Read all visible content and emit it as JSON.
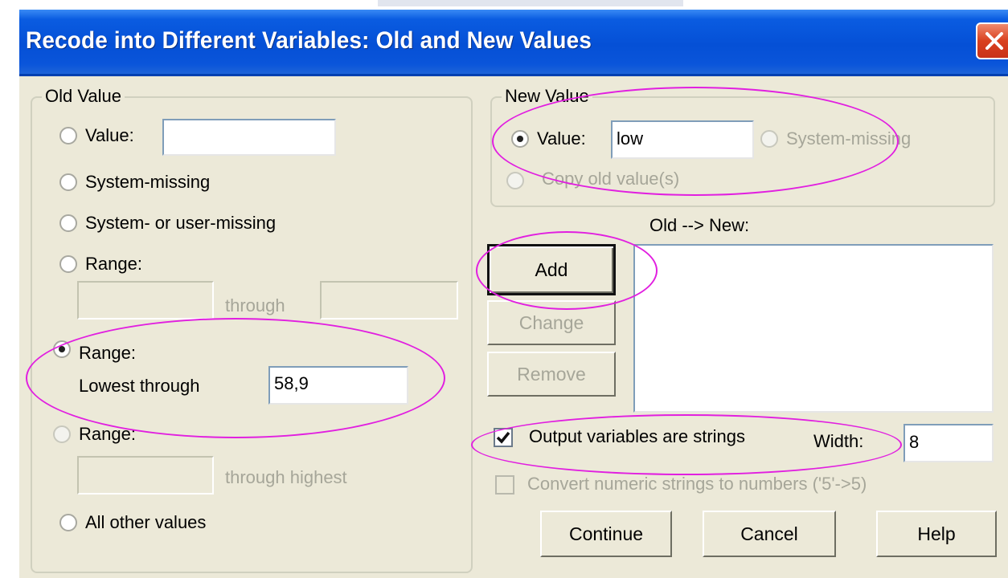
{
  "window": {
    "title": "Recode into Different Variables: Old and New Values"
  },
  "old_value": {
    "legend": "Old Value",
    "value_label": "Value:",
    "value_input": "",
    "system_missing": "System-missing",
    "system_or_user_missing": "System- or user-missing",
    "range_label": "Range:",
    "range_from": "",
    "range_through": "through",
    "range_to": "",
    "range_lowest_label": "Range:",
    "lowest_through_label": "Lowest through",
    "lowest_through_value": "58,9",
    "range_highest_label": "Range:",
    "through_highest_value": "",
    "through_highest_label": "through highest",
    "all_other_values": "All other values",
    "selected": "range_lowest"
  },
  "new_value": {
    "legend": "New Value",
    "value_label": "Value:",
    "value_input": "low",
    "system_missing": "System-missing",
    "copy_old": "Copy old value(s)",
    "selected": "value"
  },
  "mapping": {
    "label": "Old --> New:",
    "entries": []
  },
  "buttons": {
    "add": "Add",
    "change": "Change",
    "remove": "Remove",
    "continue": "Continue",
    "cancel": "Cancel",
    "help": "Help"
  },
  "options": {
    "output_strings_label": "Output variables are strings",
    "output_strings_checked": true,
    "width_label": "Width:",
    "width_value": "8",
    "convert_numeric_label": "Convert numeric strings to numbers ('5'->5)",
    "convert_numeric_checked": false
  },
  "annotation_color": "#e11fe0",
  "title_bar_color": "#0a55da"
}
